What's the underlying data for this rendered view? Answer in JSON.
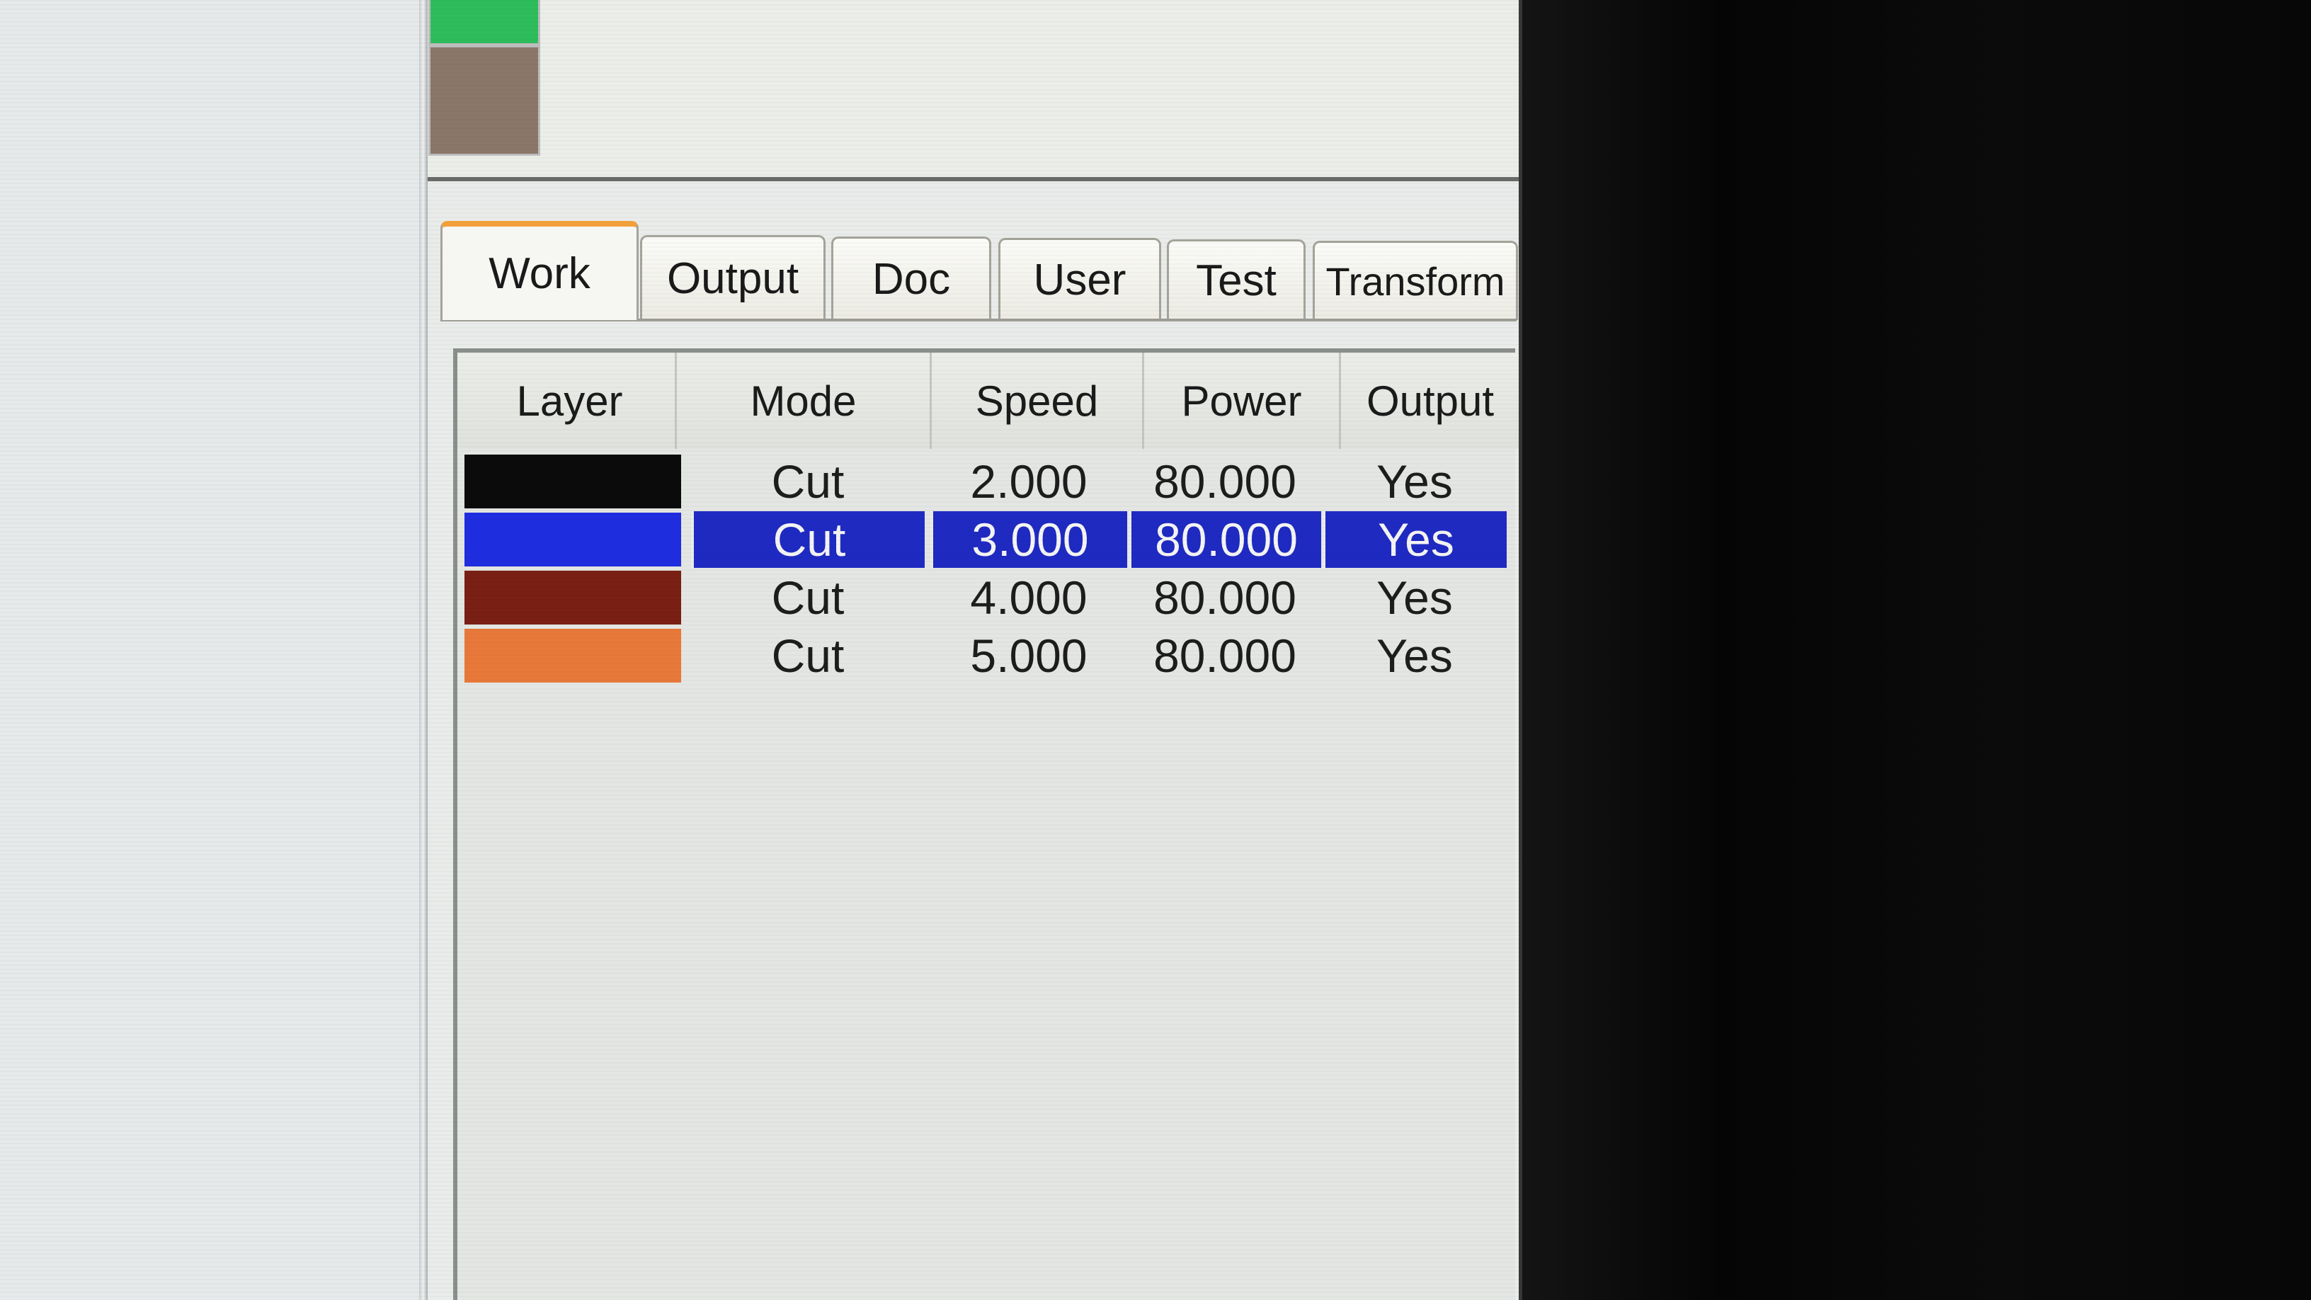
{
  "palette": {
    "swatches": [
      {
        "name": "green",
        "color": "#2ebd5c"
      },
      {
        "name": "taupe",
        "color": "#8b7768"
      }
    ]
  },
  "tabs": [
    {
      "label": "Work",
      "active": true
    },
    {
      "label": "Output",
      "active": false
    },
    {
      "label": "Doc",
      "active": false
    },
    {
      "label": "User",
      "active": false
    },
    {
      "label": "Test",
      "active": false
    },
    {
      "label": "Transform",
      "active": false
    }
  ],
  "layers_table": {
    "headers": {
      "layer": "Layer",
      "mode": "Mode",
      "speed": "Speed",
      "power": "Power",
      "output": "Output"
    },
    "rows": [
      {
        "color": "#0b0b0b",
        "mode": "Cut",
        "speed": "2.000",
        "power": "80.000",
        "output": "Yes",
        "selected": false
      },
      {
        "color": "#1f2de0",
        "mode": "Cut",
        "speed": "3.000",
        "power": "80.000",
        "output": "Yes",
        "selected": true
      },
      {
        "color": "#7a1f14",
        "mode": "Cut",
        "speed": "4.000",
        "power": "80.000",
        "output": "Yes",
        "selected": false
      },
      {
        "color": "#e8793a",
        "mode": "Cut",
        "speed": "5.000",
        "power": "80.000",
        "output": "Yes",
        "selected": false
      }
    ]
  },
  "colors": {
    "selection": "#1f2ac2",
    "active_tab_accent": "#f2a03a"
  }
}
